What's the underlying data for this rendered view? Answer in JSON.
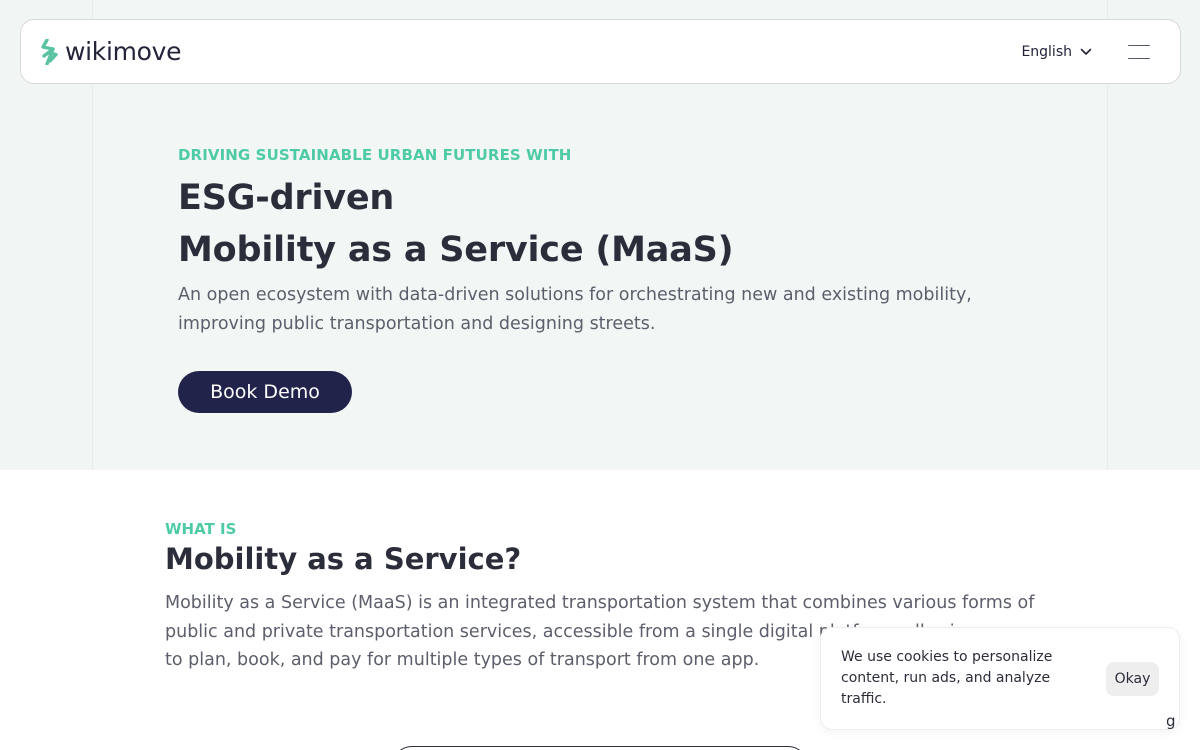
{
  "brand": {
    "name": "wikimove",
    "logo_icon": "wikimove-bolt-icon",
    "accent": "#5bc2a4"
  },
  "header": {
    "language": "English",
    "language_icon": "chevron-down-icon",
    "menu_icon": "hamburger-menu-icon"
  },
  "hero": {
    "eyebrow": "DRIVING SUSTAINABLE URBAN FUTURES WITH",
    "title_line1": "ESG-driven",
    "title_line2": "Mobility as a Service (MaaS)",
    "subtitle_line1": "An open ecosystem with data-driven solutions for orchestrating new and existing mobility,",
    "subtitle_line2": "improving public transportation and designing streets.",
    "cta_label": "Book Demo"
  },
  "what_is": {
    "eyebrow": "WHAT IS",
    "title": "Mobility as a Service?",
    "body_line1": "Mobility as a Service (MaaS) is an integrated transportation system that combines various forms of",
    "body_line2": "public and private transportation services, accessible from a single digital platform, allowing users",
    "body_line3": "to plan, book, and pay for multiple types of transport from one app."
  },
  "cookie": {
    "text": "We use cookies to personalize content, run ads, and analyze traffic.",
    "accept_label": "Okay"
  },
  "colors": {
    "accent_green": "#4ecba6",
    "navy": "#22234b",
    "hero_bg": "#f1f6f4",
    "text_dark": "#2b2d3a",
    "text_muted": "#5c5f6b"
  }
}
